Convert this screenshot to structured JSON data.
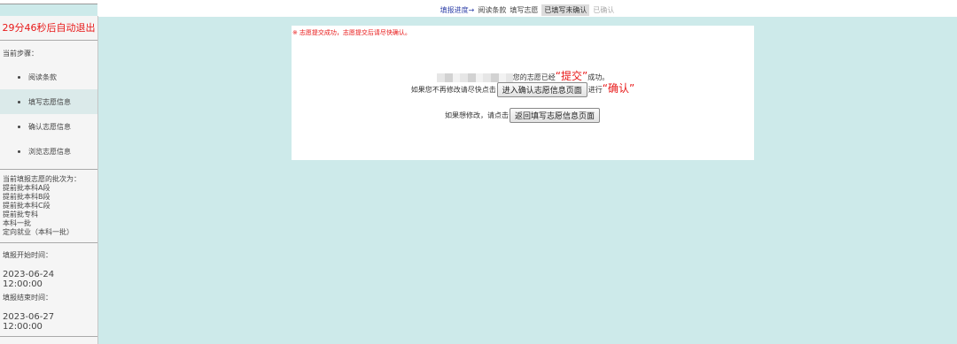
{
  "progress": {
    "step_done": "填报进度→",
    "step_read": "阅读条款",
    "step_fill": "填写志愿",
    "step_status": "已填写未确认",
    "step_confirmed": "已确认"
  },
  "sidebar": {
    "timer": "29分46秒后自动退出",
    "steps_title": "当前步骤：",
    "steps": [
      {
        "label": "阅读条款"
      },
      {
        "label": "填写志愿信息"
      },
      {
        "label": "确认志愿信息"
      },
      {
        "label": "浏览志愿信息"
      }
    ],
    "batch_title": "当前填报志愿的批次为：",
    "batches": [
      "提前批本科A段",
      "提前批本科B段",
      "提前批本科C段",
      "提前批专科",
      "本科一批",
      "定向就业（本科一批）"
    ],
    "start_label": "填报开始时间：",
    "start_time": "2023-06-24 12:00:00",
    "end_label": "填报结束时间：",
    "end_time": "2023-06-27 12:00:00"
  },
  "main": {
    "notice": "志愿提交成功，志愿提交后请尽快确认。",
    "line1_prefix": "您的志愿已经",
    "line1_highlight": "“提交”",
    "line1_suffix": "成功。",
    "line2_prefix": "如果您不再修改请尽快点击",
    "confirm_button": "进入确认志愿信息页面",
    "line2_middle": "进行",
    "line2_highlight": "“确认”",
    "line3_prefix": "如果想修改，请点击",
    "return_button": "返回填写志愿信息页面"
  },
  "colors": {
    "highlight": "#e81818",
    "background": "#cdeaea",
    "progress_link": "#3344aa"
  },
  "icons": {
    "notice": "warning-icon"
  }
}
